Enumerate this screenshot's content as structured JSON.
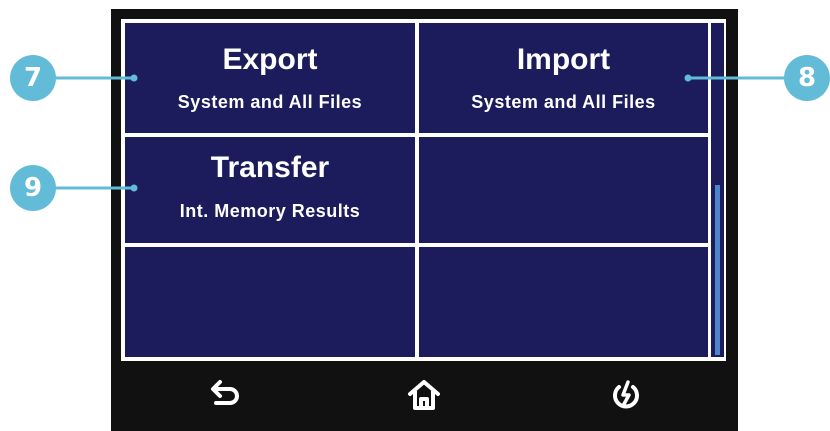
{
  "tiles": [
    {
      "title": "Export",
      "subtitle": "System and All Files"
    },
    {
      "title": "Import",
      "subtitle": "System and All Files"
    },
    {
      "title": "Transfer",
      "subtitle": "Int. Memory Results"
    },
    {
      "title": "",
      "subtitle": ""
    },
    {
      "title": "",
      "subtitle": ""
    },
    {
      "title": "",
      "subtitle": ""
    }
  ],
  "scrollbar": {
    "position": 0.55,
    "visible_fraction": 0.5
  },
  "nav": {
    "back_icon": "back-arrow-icon",
    "home_icon": "home-icon",
    "power_icon": "power-icon"
  },
  "callouts": {
    "export": "7",
    "import": "8",
    "transfer": "9"
  },
  "colors": {
    "tile_bg": "#1c1c5c",
    "bezel": "#111111",
    "callout": "#62bcd8",
    "scroll_thumb": "#4a86c8"
  }
}
